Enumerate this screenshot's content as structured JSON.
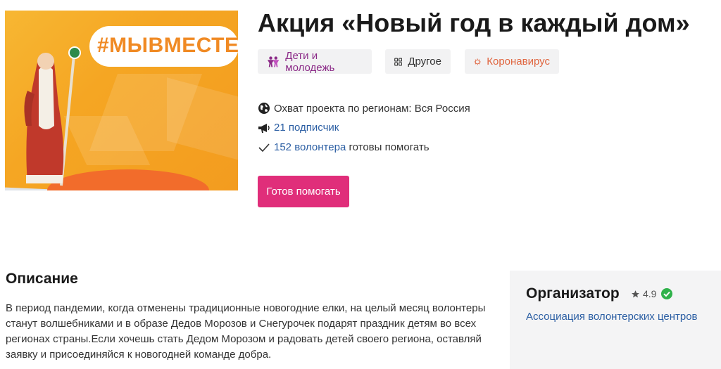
{
  "hero": {
    "banner_text": "#МЫВМЕСТЕ"
  },
  "project": {
    "title": "Акция «Новый год в каждый дом»",
    "tags": [
      {
        "label": "Дети и молодежь",
        "icon": "people-icon",
        "color": "#8b2a87"
      },
      {
        "label": "Другое",
        "icon": "grid-icon",
        "color": "#333333"
      },
      {
        "label": "Коронавирус",
        "icon": "virus-icon",
        "color": "#e0653f"
      }
    ],
    "region_label": "Охват проекта по регионам: Вся Россия",
    "subscribers": "21 подписчик",
    "volunteers_link": "152 волонтера",
    "volunteers_suffix": " готовы помогать",
    "help_button": "Готов помогать"
  },
  "description": {
    "title": "Описание",
    "text": "В период пандемии, когда отменены традиционные новогодние елки, на целый месяц волонтеры станут волшебниками и в образе Дедов Морозов и Снегурочек подарят праздник детям во всех регионах страны.Если хочешь стать Дедом Морозом и радовать детей своего региона, оставляй заявку и присоединяйся к новогодней команде добра."
  },
  "organizer": {
    "title": "Организатор",
    "rating": "4.9",
    "name": "Ассоциация волонтерских центров",
    "verified_color": "#2fb24a"
  }
}
